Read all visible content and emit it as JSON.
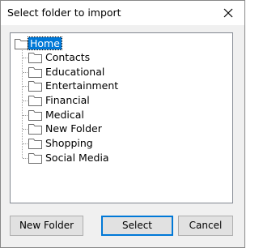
{
  "window": {
    "title": "Select folder to import",
    "close_icon": "close-icon"
  },
  "tree": {
    "root": {
      "label": "Home",
      "selected": true,
      "icon": "folder-icon"
    },
    "children": [
      {
        "label": "Contacts",
        "icon": "folder-icon"
      },
      {
        "label": "Educational",
        "icon": "folder-icon"
      },
      {
        "label": "Entertainment",
        "icon": "folder-icon"
      },
      {
        "label": "Financial",
        "icon": "folder-icon"
      },
      {
        "label": "Medical",
        "icon": "folder-icon"
      },
      {
        "label": "New Folder",
        "icon": "folder-icon"
      },
      {
        "label": "Shopping",
        "icon": "folder-icon"
      },
      {
        "label": "Social Media",
        "icon": "folder-icon"
      }
    ]
  },
  "buttons": {
    "new_folder": "New Folder",
    "select": "Select",
    "cancel": "Cancel"
  },
  "colors": {
    "selection": "#0078d7",
    "dialog_bg": "#f0f0f0",
    "folder_outline": "#6d6d6d"
  }
}
